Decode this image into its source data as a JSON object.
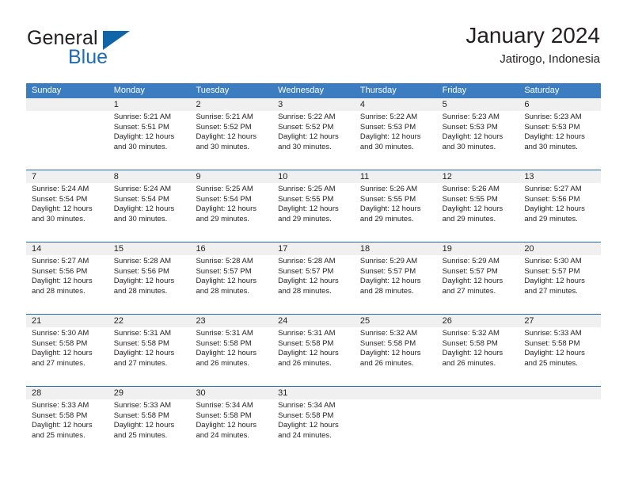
{
  "brand": {
    "general": "General",
    "blue": "Blue",
    "triangle_color": "#1064a8"
  },
  "header": {
    "title": "January 2024",
    "subtitle": "Jatirogo, Indonesia"
  },
  "theme": {
    "header_bg": "#3b7dc0",
    "row_divider": "#1f6cb4",
    "date_band_bg": "#f0f0f0",
    "text": "#231f20"
  },
  "weekdays": [
    "Sunday",
    "Monday",
    "Tuesday",
    "Wednesday",
    "Thursday",
    "Friday",
    "Saturday"
  ],
  "weeks": [
    [
      {
        "day": "",
        "sunrise": "",
        "sunset": "",
        "daylight1": "",
        "daylight2": ""
      },
      {
        "day": "1",
        "sunrise": "Sunrise: 5:21 AM",
        "sunset": "Sunset: 5:51 PM",
        "daylight1": "Daylight: 12 hours",
        "daylight2": "and 30 minutes."
      },
      {
        "day": "2",
        "sunrise": "Sunrise: 5:21 AM",
        "sunset": "Sunset: 5:52 PM",
        "daylight1": "Daylight: 12 hours",
        "daylight2": "and 30 minutes."
      },
      {
        "day": "3",
        "sunrise": "Sunrise: 5:22 AM",
        "sunset": "Sunset: 5:52 PM",
        "daylight1": "Daylight: 12 hours",
        "daylight2": "and 30 minutes."
      },
      {
        "day": "4",
        "sunrise": "Sunrise: 5:22 AM",
        "sunset": "Sunset: 5:53 PM",
        "daylight1": "Daylight: 12 hours",
        "daylight2": "and 30 minutes."
      },
      {
        "day": "5",
        "sunrise": "Sunrise: 5:23 AM",
        "sunset": "Sunset: 5:53 PM",
        "daylight1": "Daylight: 12 hours",
        "daylight2": "and 30 minutes."
      },
      {
        "day": "6",
        "sunrise": "Sunrise: 5:23 AM",
        "sunset": "Sunset: 5:53 PM",
        "daylight1": "Daylight: 12 hours",
        "daylight2": "and 30 minutes."
      }
    ],
    [
      {
        "day": "7",
        "sunrise": "Sunrise: 5:24 AM",
        "sunset": "Sunset: 5:54 PM",
        "daylight1": "Daylight: 12 hours",
        "daylight2": "and 30 minutes."
      },
      {
        "day": "8",
        "sunrise": "Sunrise: 5:24 AM",
        "sunset": "Sunset: 5:54 PM",
        "daylight1": "Daylight: 12 hours",
        "daylight2": "and 30 minutes."
      },
      {
        "day": "9",
        "sunrise": "Sunrise: 5:25 AM",
        "sunset": "Sunset: 5:54 PM",
        "daylight1": "Daylight: 12 hours",
        "daylight2": "and 29 minutes."
      },
      {
        "day": "10",
        "sunrise": "Sunrise: 5:25 AM",
        "sunset": "Sunset: 5:55 PM",
        "daylight1": "Daylight: 12 hours",
        "daylight2": "and 29 minutes."
      },
      {
        "day": "11",
        "sunrise": "Sunrise: 5:26 AM",
        "sunset": "Sunset: 5:55 PM",
        "daylight1": "Daylight: 12 hours",
        "daylight2": "and 29 minutes."
      },
      {
        "day": "12",
        "sunrise": "Sunrise: 5:26 AM",
        "sunset": "Sunset: 5:55 PM",
        "daylight1": "Daylight: 12 hours",
        "daylight2": "and 29 minutes."
      },
      {
        "day": "13",
        "sunrise": "Sunrise: 5:27 AM",
        "sunset": "Sunset: 5:56 PM",
        "daylight1": "Daylight: 12 hours",
        "daylight2": "and 29 minutes."
      }
    ],
    [
      {
        "day": "14",
        "sunrise": "Sunrise: 5:27 AM",
        "sunset": "Sunset: 5:56 PM",
        "daylight1": "Daylight: 12 hours",
        "daylight2": "and 28 minutes."
      },
      {
        "day": "15",
        "sunrise": "Sunrise: 5:28 AM",
        "sunset": "Sunset: 5:56 PM",
        "daylight1": "Daylight: 12 hours",
        "daylight2": "and 28 minutes."
      },
      {
        "day": "16",
        "sunrise": "Sunrise: 5:28 AM",
        "sunset": "Sunset: 5:57 PM",
        "daylight1": "Daylight: 12 hours",
        "daylight2": "and 28 minutes."
      },
      {
        "day": "17",
        "sunrise": "Sunrise: 5:28 AM",
        "sunset": "Sunset: 5:57 PM",
        "daylight1": "Daylight: 12 hours",
        "daylight2": "and 28 minutes."
      },
      {
        "day": "18",
        "sunrise": "Sunrise: 5:29 AM",
        "sunset": "Sunset: 5:57 PM",
        "daylight1": "Daylight: 12 hours",
        "daylight2": "and 28 minutes."
      },
      {
        "day": "19",
        "sunrise": "Sunrise: 5:29 AM",
        "sunset": "Sunset: 5:57 PM",
        "daylight1": "Daylight: 12 hours",
        "daylight2": "and 27 minutes."
      },
      {
        "day": "20",
        "sunrise": "Sunrise: 5:30 AM",
        "sunset": "Sunset: 5:57 PM",
        "daylight1": "Daylight: 12 hours",
        "daylight2": "and 27 minutes."
      }
    ],
    [
      {
        "day": "21",
        "sunrise": "Sunrise: 5:30 AM",
        "sunset": "Sunset: 5:58 PM",
        "daylight1": "Daylight: 12 hours",
        "daylight2": "and 27 minutes."
      },
      {
        "day": "22",
        "sunrise": "Sunrise: 5:31 AM",
        "sunset": "Sunset: 5:58 PM",
        "daylight1": "Daylight: 12 hours",
        "daylight2": "and 27 minutes."
      },
      {
        "day": "23",
        "sunrise": "Sunrise: 5:31 AM",
        "sunset": "Sunset: 5:58 PM",
        "daylight1": "Daylight: 12 hours",
        "daylight2": "and 26 minutes."
      },
      {
        "day": "24",
        "sunrise": "Sunrise: 5:31 AM",
        "sunset": "Sunset: 5:58 PM",
        "daylight1": "Daylight: 12 hours",
        "daylight2": "and 26 minutes."
      },
      {
        "day": "25",
        "sunrise": "Sunrise: 5:32 AM",
        "sunset": "Sunset: 5:58 PM",
        "daylight1": "Daylight: 12 hours",
        "daylight2": "and 26 minutes."
      },
      {
        "day": "26",
        "sunrise": "Sunrise: 5:32 AM",
        "sunset": "Sunset: 5:58 PM",
        "daylight1": "Daylight: 12 hours",
        "daylight2": "and 26 minutes."
      },
      {
        "day": "27",
        "sunrise": "Sunrise: 5:33 AM",
        "sunset": "Sunset: 5:58 PM",
        "daylight1": "Daylight: 12 hours",
        "daylight2": "and 25 minutes."
      }
    ],
    [
      {
        "day": "28",
        "sunrise": "Sunrise: 5:33 AM",
        "sunset": "Sunset: 5:58 PM",
        "daylight1": "Daylight: 12 hours",
        "daylight2": "and 25 minutes."
      },
      {
        "day": "29",
        "sunrise": "Sunrise: 5:33 AM",
        "sunset": "Sunset: 5:58 PM",
        "daylight1": "Daylight: 12 hours",
        "daylight2": "and 25 minutes."
      },
      {
        "day": "30",
        "sunrise": "Sunrise: 5:34 AM",
        "sunset": "Sunset: 5:58 PM",
        "daylight1": "Daylight: 12 hours",
        "daylight2": "and 24 minutes."
      },
      {
        "day": "31",
        "sunrise": "Sunrise: 5:34 AM",
        "sunset": "Sunset: 5:58 PM",
        "daylight1": "Daylight: 12 hours",
        "daylight2": "and 24 minutes."
      },
      {
        "day": "",
        "sunrise": "",
        "sunset": "",
        "daylight1": "",
        "daylight2": ""
      },
      {
        "day": "",
        "sunrise": "",
        "sunset": "",
        "daylight1": "",
        "daylight2": ""
      },
      {
        "day": "",
        "sunrise": "",
        "sunset": "",
        "daylight1": "",
        "daylight2": ""
      }
    ]
  ]
}
